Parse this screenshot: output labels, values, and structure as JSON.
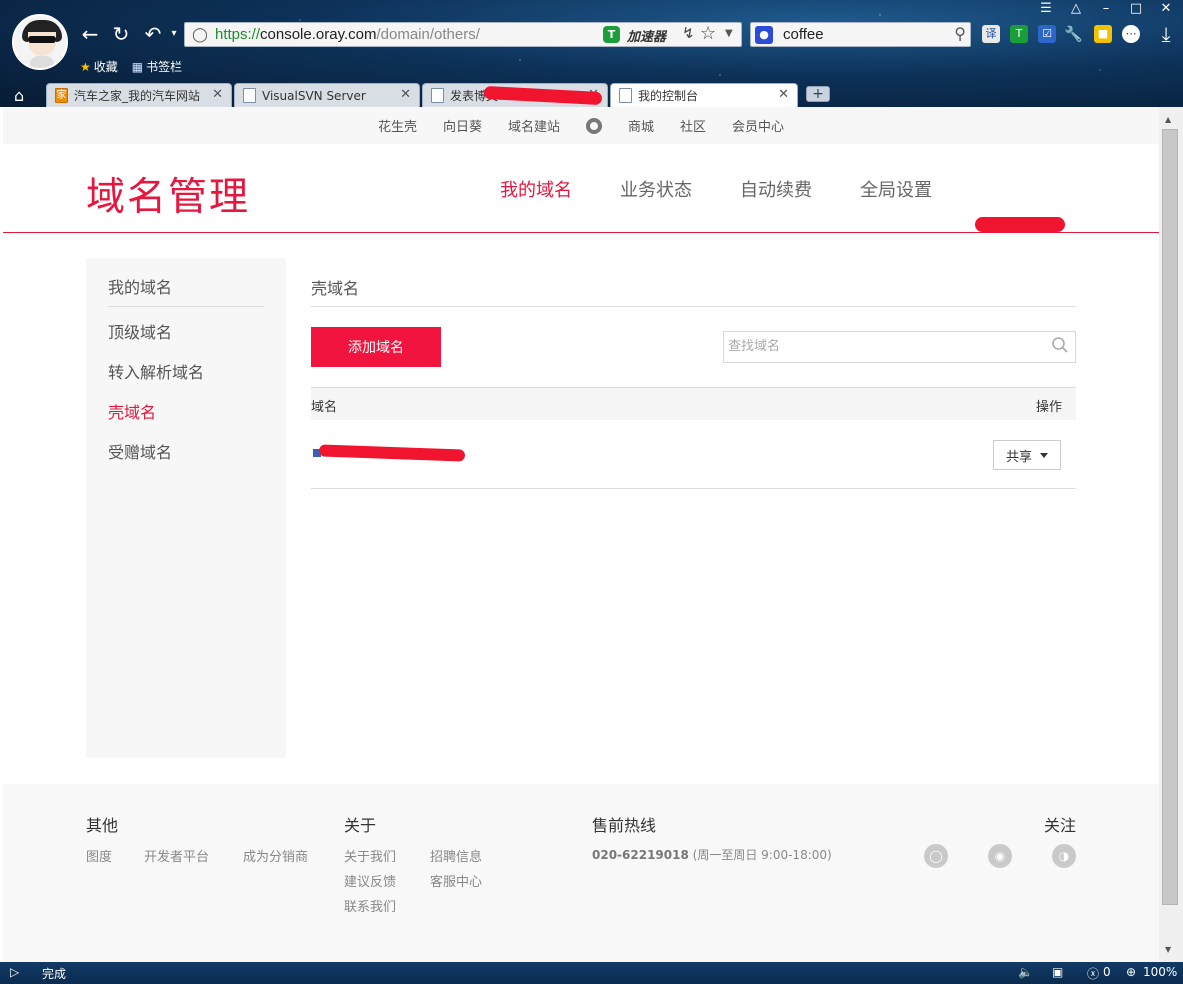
{
  "browser": {
    "address": {
      "scheme": "https://",
      "host": "console.oray.com",
      "path": "/domain/others/"
    },
    "accelerator_label": "加速器",
    "search_query": "coffee",
    "bookmarks": [
      {
        "label": "收藏",
        "icon": "star-icon"
      },
      {
        "label": "书签栏",
        "icon": "folder-icon"
      }
    ],
    "tabs": [
      {
        "label": "汽车之家_我的汽车网站",
        "icon_text": "家"
      },
      {
        "label": "VisualSVN Server"
      },
      {
        "label": "发表博文"
      },
      {
        "label": "我的控制台"
      }
    ]
  },
  "topnav": {
    "items": [
      "花生壳",
      "向日葵",
      "域名建站",
      "商城",
      "社区",
      "会员中心"
    ]
  },
  "header": {
    "title": "域名管理",
    "nav": [
      {
        "label": "我的域名",
        "active": true
      },
      {
        "label": "业务状态",
        "active": false
      },
      {
        "label": "自动续费",
        "active": false
      },
      {
        "label": "全局设置",
        "active": false
      }
    ]
  },
  "sidebar": {
    "items": [
      {
        "label": "我的域名",
        "active": false
      },
      {
        "label": "顶级域名",
        "active": false
      },
      {
        "label": "转入解析域名",
        "active": false
      },
      {
        "label": "壳域名",
        "active": true
      },
      {
        "label": "受赠域名",
        "active": false
      }
    ]
  },
  "main": {
    "section_title": "壳域名",
    "add_button": "添加域名",
    "search_placeholder": "查找域名",
    "table": {
      "col_domain": "域名",
      "col_action": "操作",
      "rows": [
        {
          "action": "共享"
        }
      ]
    }
  },
  "footer": {
    "other": {
      "heading": "其他",
      "links": [
        "图度",
        "开发者平台",
        "成为分销商"
      ]
    },
    "about": {
      "heading": "关于",
      "links": [
        "关于我们",
        "招聘信息",
        "建议反馈",
        "客服中心",
        "联系我们"
      ]
    },
    "hotline": {
      "heading": "售前热线",
      "number": "020-62219018",
      "hours": "(周一至周日 9:00-18:00)"
    },
    "follow": {
      "heading": "关注"
    }
  },
  "statusbar": {
    "text": "完成",
    "count": "0",
    "zoom": "100%"
  },
  "colors": {
    "brand_red": "#e5173f",
    "button_red": "#f0143f",
    "chrome_blue": "#0d3158"
  }
}
